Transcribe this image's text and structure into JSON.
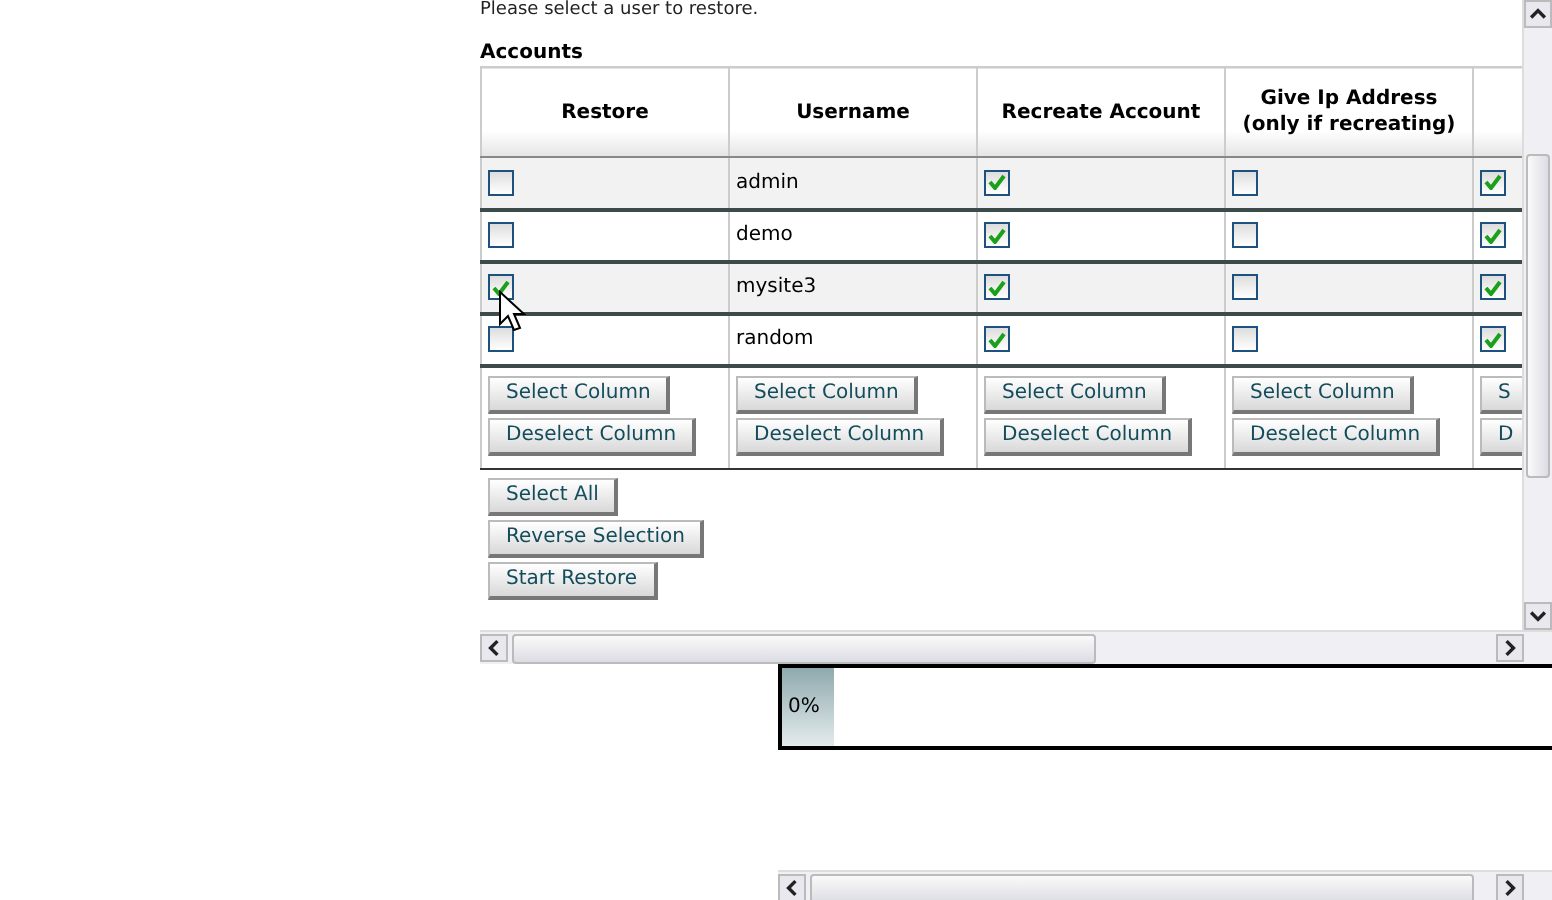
{
  "intro": "Please select a user to restore.",
  "section_title": "Accounts",
  "table": {
    "columns": [
      "Restore",
      "Username",
      "Recreate Account",
      "Give Ip Address (only if recreating)",
      ""
    ],
    "rows": [
      {
        "restore": false,
        "username": "admin",
        "recreate": true,
        "give_ip": false,
        "column_5": true
      },
      {
        "restore": false,
        "username": "demo",
        "recreate": true,
        "give_ip": false,
        "column_5": true
      },
      {
        "restore": true,
        "username": "mysite3",
        "recreate": true,
        "give_ip": false,
        "column_5": true
      },
      {
        "restore": false,
        "username": "random",
        "recreate": true,
        "give_ip": false,
        "column_5": true
      }
    ],
    "column_buttons": [
      {
        "select": "Select Column",
        "deselect": "Deselect Column"
      },
      {
        "select": "Select Column",
        "deselect": "Deselect Column"
      },
      {
        "select": "Select Column",
        "deselect": "Deselect Column"
      },
      {
        "select": "Select Column",
        "deselect": "Deselect Column"
      },
      {
        "select": "S",
        "deselect": "D"
      }
    ]
  },
  "actions": [
    "Select All",
    "Reverse Selection",
    "Start Restore"
  ],
  "progress": {
    "level": 0,
    "reading": "0%"
  }
}
